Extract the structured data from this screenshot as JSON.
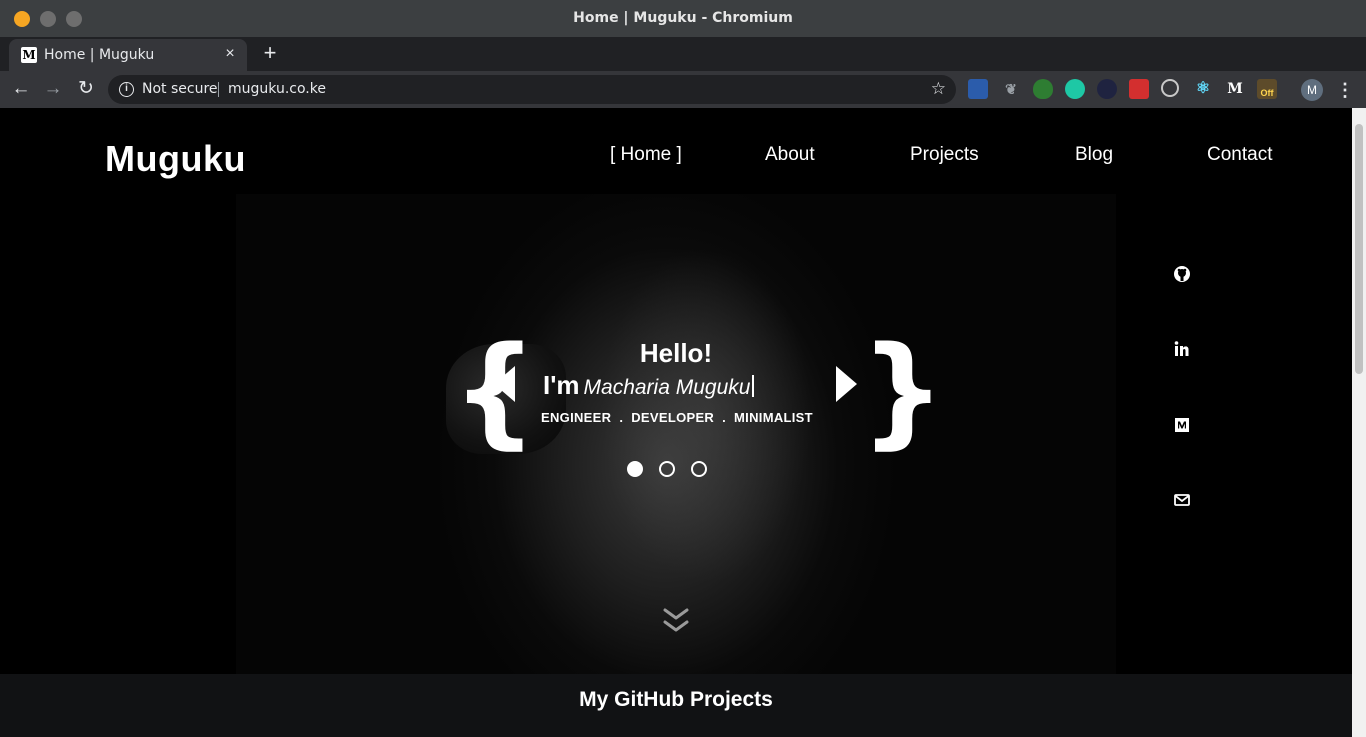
{
  "window": {
    "title": "Home | Muguku - Chromium"
  },
  "tab": {
    "title": "Home | Muguku",
    "favicon_letter": "M",
    "close": "×"
  },
  "toolbar": {
    "new_tab": "+",
    "back": "←",
    "forward": "→",
    "reload": "↻",
    "info": "i",
    "security_label": "Not secure",
    "url": "muguku.co.ke",
    "star": "☆",
    "profile_initial": "M",
    "menu": "⋮",
    "extensions": [
      "ext-blue-icon",
      "ext-paw-icon",
      "ext-shield-icon",
      "ext-lock-icon",
      "ext-dark-icon",
      "ext-pin-icon",
      "ext-target-icon",
      "ext-react-icon",
      "ext-medium-icon",
      "ext-off-icon"
    ],
    "ext_medium_letter": "M",
    "ext_off_label": "Off"
  },
  "site": {
    "brand": "Muguku",
    "nav": {
      "home": "[ Home ]",
      "about": "About",
      "projects": "Projects",
      "blog": "Blog",
      "contact": "Contact"
    },
    "hero": {
      "brace_left": "{",
      "brace_right": "}",
      "hello": "Hello!",
      "im": "I'm",
      "name": "Macharia Muguku",
      "tags": [
        "ENGINEER",
        "DEVELOPER",
        "MINIMALIST"
      ],
      "tag_separator": "."
    },
    "social": [
      "github-icon",
      "linkedin-icon",
      "medium-icon",
      "mail-icon"
    ],
    "section_title": "My GitHub Projects"
  },
  "colors": {
    "accent": "#f6a623",
    "page_bg": "#000000",
    "section_bg": "#111214"
  }
}
